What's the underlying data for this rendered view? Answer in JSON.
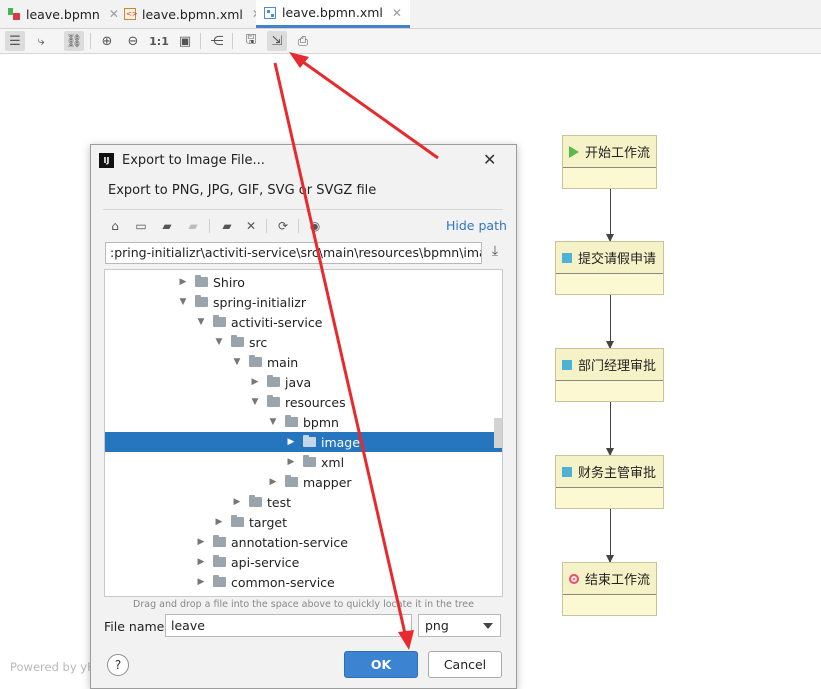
{
  "tabs": [
    {
      "label": "leave.bpmn",
      "icon": "bpmn-file-icon",
      "active": false
    },
    {
      "label": "leave.bpmn.xml",
      "icon": "xml-file-icon",
      "active": false
    },
    {
      "label": "leave.bpmn.xml",
      "icon": "diagram-icon",
      "active": true
    }
  ],
  "toolbar": {
    "icons": [
      "properties-icon",
      "edge-routing-icon",
      "link-icon",
      "zoom-in-icon",
      "zoom-out-icon",
      "actual-size-icon",
      "fit-content-icon",
      "layout-icon",
      "save-icon",
      "export-icon",
      "print-icon"
    ],
    "actual_size_label": "1:1"
  },
  "diagram": {
    "nodes": [
      {
        "label": "开始工作流",
        "kind": "start",
        "icon": "start-event-icon"
      },
      {
        "label": "提交请假申请",
        "kind": "task",
        "icon": "task-icon"
      },
      {
        "label": "部门经理审批",
        "kind": "task",
        "icon": "task-icon"
      },
      {
        "label": "财务主管审批",
        "kind": "task",
        "icon": "task-icon"
      },
      {
        "label": "结束工作流",
        "kind": "end",
        "icon": "end-event-icon"
      }
    ],
    "powered_by": "Powered by yF"
  },
  "dialog": {
    "title": "Export to Image File...",
    "description": "Export to PNG, JPG, GIF, SVG or SVGZ file",
    "hide_path_label": "Hide path",
    "path_value": ":pring-initializr\\activiti-service\\src\\main\\resources\\bpmn\\image",
    "tree": [
      {
        "label": "Shiro",
        "expanded": false
      },
      {
        "label": "spring-initializr",
        "expanded": true
      },
      {
        "label": "activiti-service",
        "expanded": true
      },
      {
        "label": "src",
        "expanded": true
      },
      {
        "label": "main",
        "expanded": true
      },
      {
        "label": "java",
        "expanded": false
      },
      {
        "label": "resources",
        "expanded": true
      },
      {
        "label": "bpmn",
        "expanded": true
      },
      {
        "label": "image",
        "expanded": false,
        "selected": true
      },
      {
        "label": "xml",
        "expanded": false
      },
      {
        "label": "mapper",
        "expanded": false
      },
      {
        "label": "test",
        "expanded": false
      },
      {
        "label": "target",
        "expanded": false
      },
      {
        "label": "annotation-service",
        "expanded": false
      },
      {
        "label": "api-service",
        "expanded": false
      },
      {
        "label": "common-service",
        "expanded": false
      }
    ],
    "drag_hint": "Drag and drop a file into the space above to quickly locate it in the tree",
    "file_name_label": "File name:",
    "file_name_value": "leave",
    "format_value": "png",
    "help_label": "?",
    "ok_label": "OK",
    "cancel_label": "Cancel"
  },
  "colors": {
    "accent": "#2675bf",
    "annotation_arrow": "#e8292d",
    "node_fill": "#fbf8d2"
  }
}
